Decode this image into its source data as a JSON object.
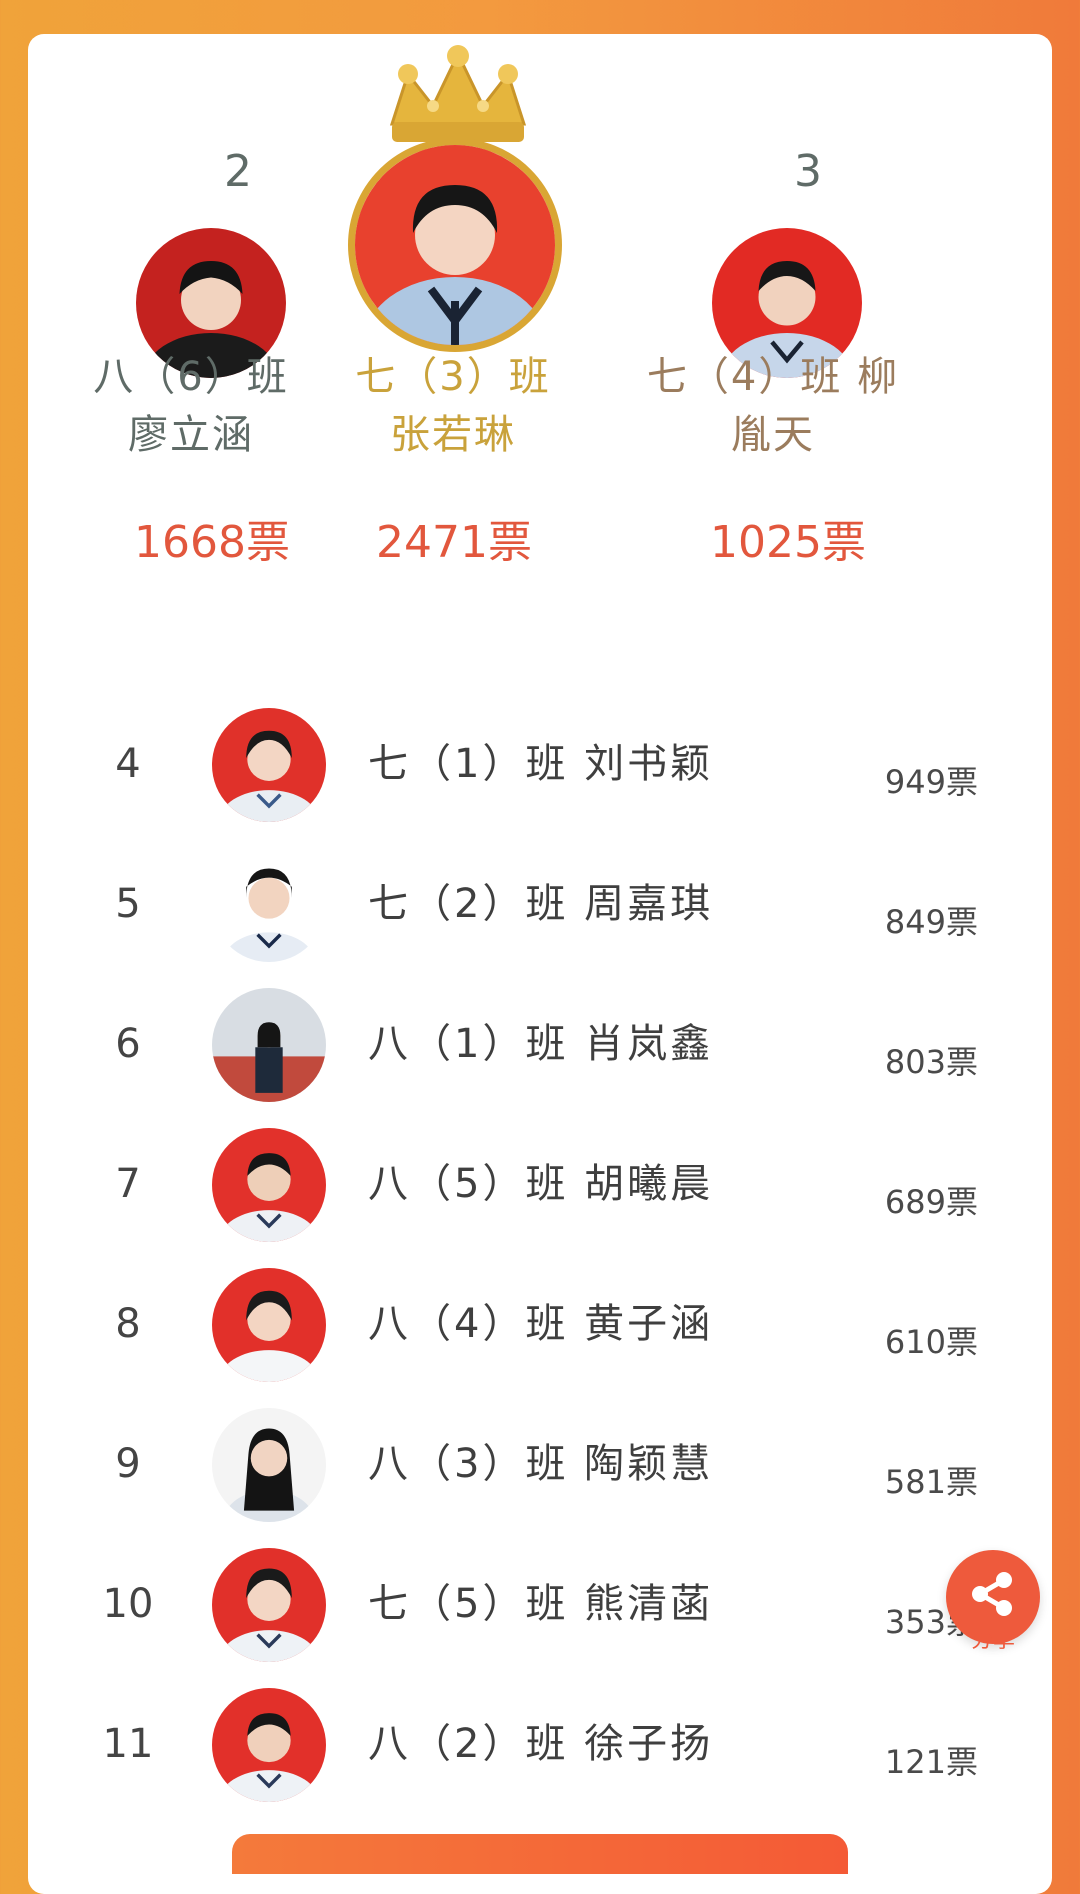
{
  "podium": {
    "first": {
      "name": "七（3）班 张若琳",
      "votes": "2471票"
    },
    "second": {
      "rank": "2",
      "name": "八（6）班 廖立涵",
      "votes": "1668票"
    },
    "third": {
      "rank": "3",
      "name": "七（4）班 柳胤天",
      "votes": "1025票"
    }
  },
  "list": [
    {
      "rank": "4",
      "name": "七（1）班 刘书颖",
      "votes": "949票"
    },
    {
      "rank": "5",
      "name": "七（2）班 周嘉琪",
      "votes": "849票"
    },
    {
      "rank": "6",
      "name": "八（1）班 肖岚鑫",
      "votes": "803票"
    },
    {
      "rank": "7",
      "name": "八（5）班 胡曦晨",
      "votes": "689票"
    },
    {
      "rank": "8",
      "name": "八（4）班 黄子涵",
      "votes": "610票"
    },
    {
      "rank": "9",
      "name": "八（3）班 陶颖慧",
      "votes": "581票"
    },
    {
      "rank": "10",
      "name": "七（5）班 熊清菡",
      "votes": "353票"
    },
    {
      "rank": "11",
      "name": "八（2）班 徐子扬",
      "votes": "121票"
    }
  ],
  "share": {
    "label": "分享",
    "icon": "share-icon"
  },
  "colors": {
    "accent": "#ee5a3c",
    "gold": "#c9a23b",
    "votes": "#e2573d",
    "podium_bg": "#e8412e"
  }
}
